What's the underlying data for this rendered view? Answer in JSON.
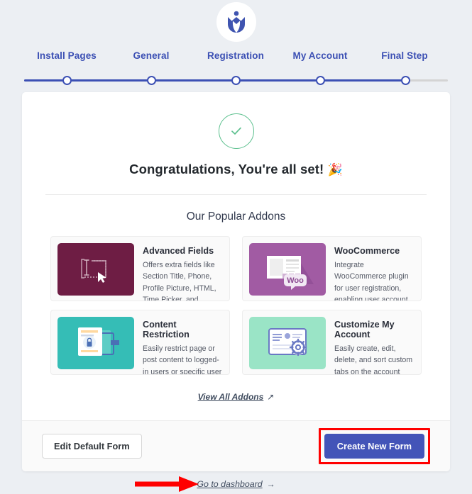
{
  "branding": {
    "logo_icon": "user-registration-tulip-logo",
    "logo_color": "#3f54b0"
  },
  "stepper": {
    "steps": [
      {
        "label": "Install Pages",
        "state": "complete"
      },
      {
        "label": "General",
        "state": "complete"
      },
      {
        "label": "Registration",
        "state": "complete"
      },
      {
        "label": "My Account",
        "state": "complete"
      },
      {
        "label": "Final Step",
        "state": "current"
      }
    ],
    "active_color": "#3c50b4",
    "inactive_color": "#d4d4d4"
  },
  "success": {
    "icon": "check-circle-icon",
    "icon_color": "#5cc08e",
    "heading": "Congratulations, You're all set!",
    "emoji": "🎉"
  },
  "addons_section": {
    "title": "Our Popular Addons",
    "items": [
      {
        "name": "Advanced Fields",
        "description": "Offers extra fields like Section Title, Phone, Profile Picture, HTML, Time Picker, and",
        "thumb_color": "#6e1d44",
        "icon": "advanced-fields-icon"
      },
      {
        "name": "WooCommerce",
        "description": "Integrate WooCommerce plugin for user registration, enabling user account management of",
        "thumb_color": "#a15ba3",
        "icon": "woocommerce-icon"
      },
      {
        "name": "Content Restriction",
        "description": "Easily restrict page or post content to logged-in users or specific user roles with this",
        "thumb_color": "#35bdb6",
        "icon": "content-restriction-lock-icon"
      },
      {
        "name": "Customize My Account",
        "description": "Easily create, edit, delete, and sort custom tabs on the account page with custom content",
        "thumb_color": "#9ae4c6",
        "icon": "customize-my-account-gear-icon"
      }
    ],
    "view_all_label": "View All Addons",
    "view_all_arrow": "↗"
  },
  "footer": {
    "secondary_button": "Edit Default Form",
    "primary_button": "Create New Form",
    "primary_highlight_color": "#ff0000",
    "primary_button_color": "#4354b8"
  },
  "bottom": {
    "dashboard_link": "Go to dashboard",
    "dashboard_arrow": "→",
    "annotation_arrow": "red-pointer-arrow"
  }
}
